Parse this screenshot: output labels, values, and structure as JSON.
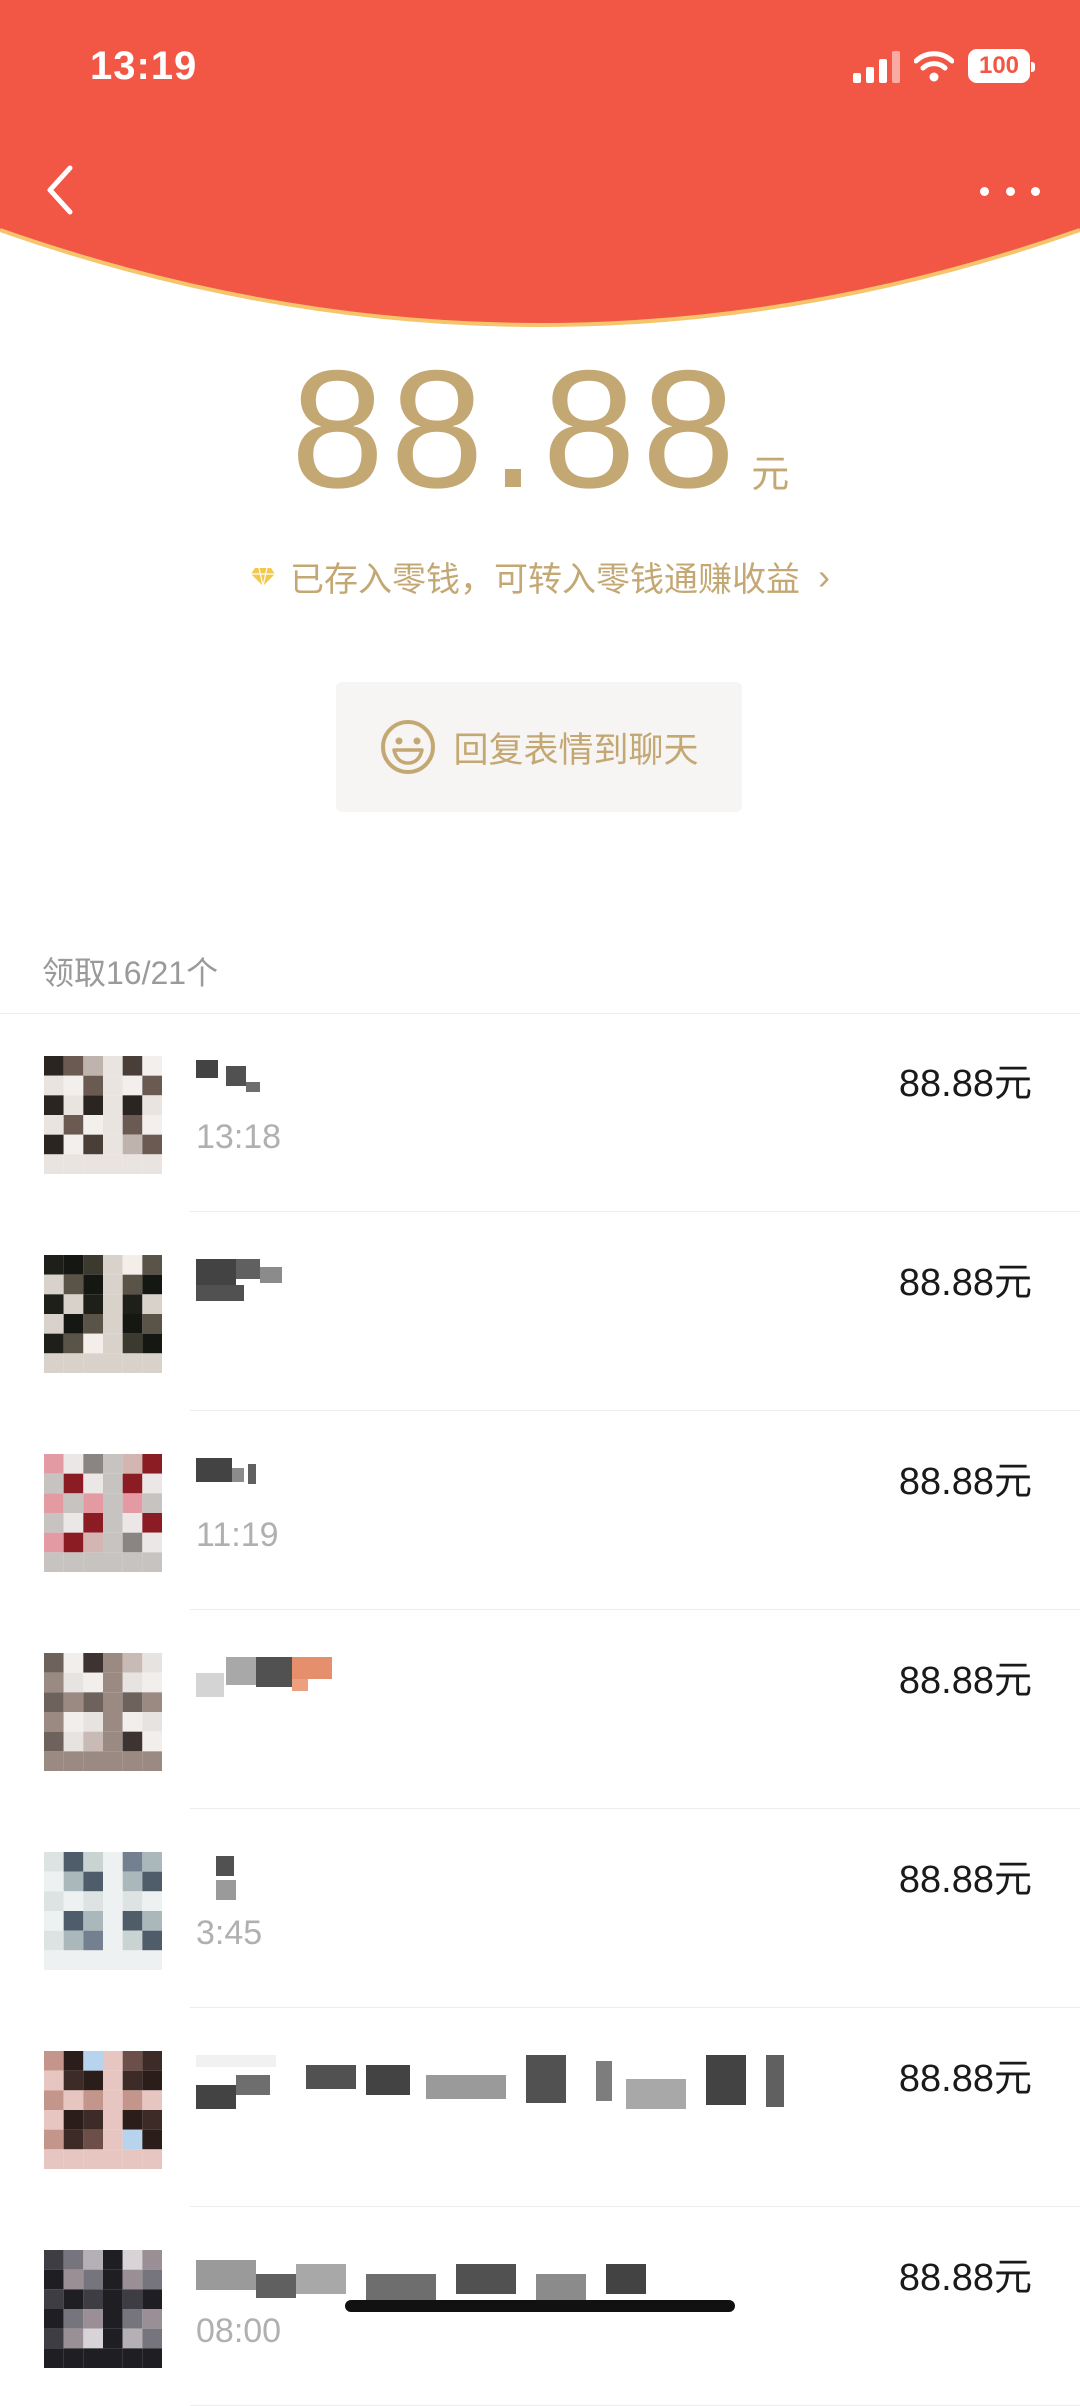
{
  "status_bar": {
    "time": "13:19",
    "battery": "100"
  },
  "colors": {
    "header": "#f25746",
    "gold": "#c4a874",
    "text_gray": "#9a9a9a"
  },
  "header": {
    "back_icon": "chevron-left-icon",
    "more_icon": "more-dots-icon"
  },
  "amount": {
    "value": "88.88",
    "unit": "元"
  },
  "notice": {
    "text": "已存入零钱，可转入零钱通赚收益",
    "icon": "diamond-icon",
    "arrow": "›"
  },
  "reply_button": {
    "label": "回复表情到聊天",
    "icon": "smiley-icon"
  },
  "list": {
    "count_label": "领取16/21个",
    "rows": [
      {
        "time": "13:18",
        "amount": "88.88元"
      },
      {
        "time": "",
        "amount": "88.88元"
      },
      {
        "time": "11:19",
        "amount": "88.88元"
      },
      {
        "time": "",
        "amount": "88.88元"
      },
      {
        "time": "3:45",
        "amount": "88.88元"
      },
      {
        "time": "",
        "amount": "88.88元"
      },
      {
        "time": "08:00",
        "amount": "88.88元"
      }
    ]
  }
}
